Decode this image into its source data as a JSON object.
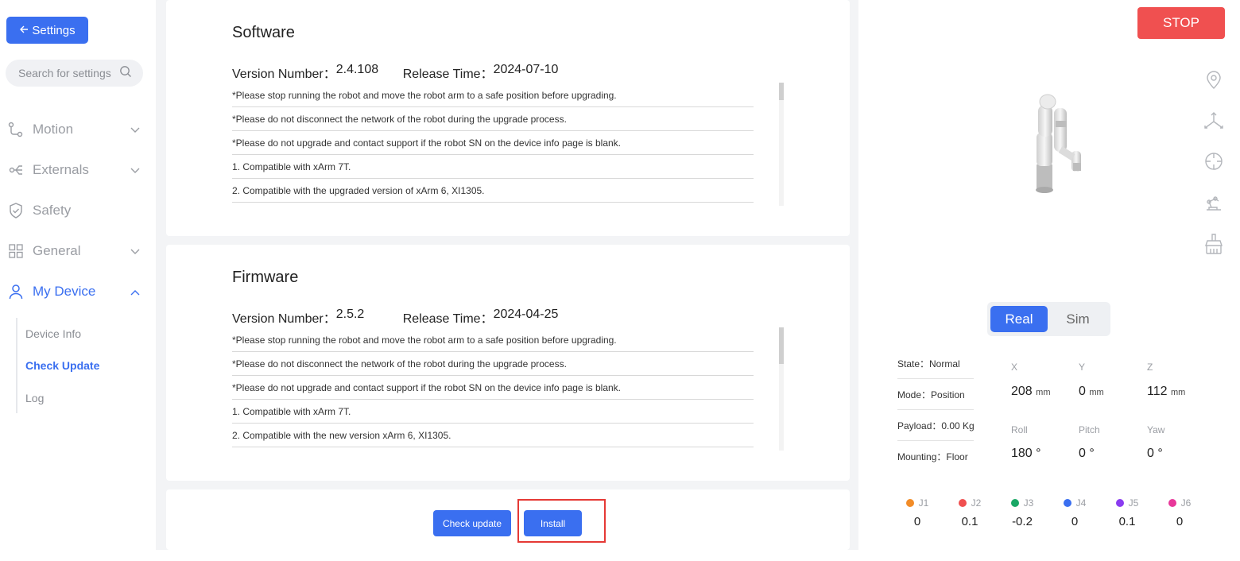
{
  "sidebar": {
    "back_label": "Settings",
    "search_placeholder": "Search for settings",
    "nav": [
      {
        "label": "Motion"
      },
      {
        "label": "Externals"
      },
      {
        "label": "Safety"
      },
      {
        "label": "General"
      },
      {
        "label": "My Device"
      }
    ],
    "sub": [
      {
        "label": "Device Info"
      },
      {
        "label": "Check Update"
      },
      {
        "label": "Log"
      }
    ]
  },
  "software": {
    "title": "Software",
    "version_label": "Version Number：",
    "version": "2.4.108",
    "release_label": "Release Time：",
    "release": "2024-07-10",
    "notes": [
      "*Please stop running the robot and move the robot arm to a safe position before upgrading.",
      "*Please do not disconnect the network of the robot during the upgrade process.",
      "*Please do not upgrade and contact support if the robot SN on the device info page is blank.",
      "1. Compatible with xArm 7T.",
      "2. Compatible with the upgraded version of xArm 6, XI1305."
    ]
  },
  "firmware": {
    "title": "Firmware",
    "version_label": "Version Number：",
    "version": "2.5.2",
    "release_label": "Release Time：",
    "release": "2024-04-25",
    "notes": [
      "*Please stop running the robot and move the robot arm to a safe position before upgrading.",
      "*Please do not disconnect the network of the robot during the upgrade process.",
      "*Please do not upgrade and contact support if the robot SN on the device info page is blank.",
      "1. Compatible with xArm 7T.",
      "2. Compatible with the new version xArm 6, XI1305."
    ]
  },
  "actions": {
    "check_update": "Check update",
    "install": "Install"
  },
  "right": {
    "stop": "STOP",
    "mode_real": "Real",
    "mode_sim": "Sim",
    "state": "State：Normal",
    "mode": "Mode：Position",
    "payload": "Payload：0.00 Kg",
    "mounting": "Mounting：Floor",
    "coords": {
      "x_label": "X",
      "x": "208",
      "y_label": "Y",
      "y": "0",
      "z_label": "Z",
      "z": "112",
      "unit_mm": "mm",
      "roll_label": "Roll",
      "roll": "180 °",
      "pitch_label": "Pitch",
      "pitch": "0 °",
      "yaw_label": "Yaw",
      "yaw": "0 °"
    },
    "joints": [
      {
        "label": "J1",
        "value": "0",
        "color": "#f28c28"
      },
      {
        "label": "J2",
        "value": "0.1",
        "color": "#f05050"
      },
      {
        "label": "J3",
        "value": "-0.2",
        "color": "#1aa866"
      },
      {
        "label": "J4",
        "value": "0",
        "color": "#3a6ff0"
      },
      {
        "label": "J5",
        "value": "0.1",
        "color": "#8a3cf0"
      },
      {
        "label": "J6",
        "value": "0",
        "color": "#e8389a"
      }
    ]
  },
  "colors": {
    "accent": "#3a6ff0",
    "stop": "#f05050",
    "highlight": "#e53935"
  }
}
